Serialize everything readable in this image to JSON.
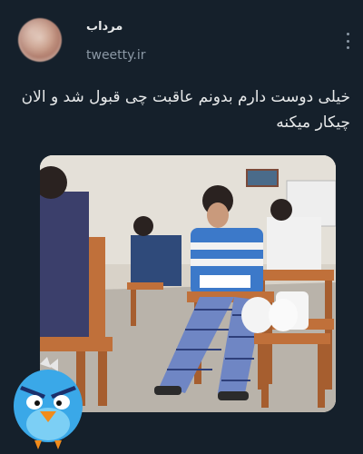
{
  "tweet": {
    "display_name": "مرداب",
    "handle": "tweetty.ir",
    "text": "خیلی دوست دارم بدونم عاقبت چی قبول شد و الان چیکار میکنه"
  },
  "icons": {
    "more": "more-vertical-icon",
    "mascot": "angry-bird-mascot-icon"
  },
  "colors": {
    "background": "#15202b",
    "text": "#e7e9ea",
    "secondary_text": "#8b98a5",
    "mascot_blue": "#3aa8e8"
  }
}
